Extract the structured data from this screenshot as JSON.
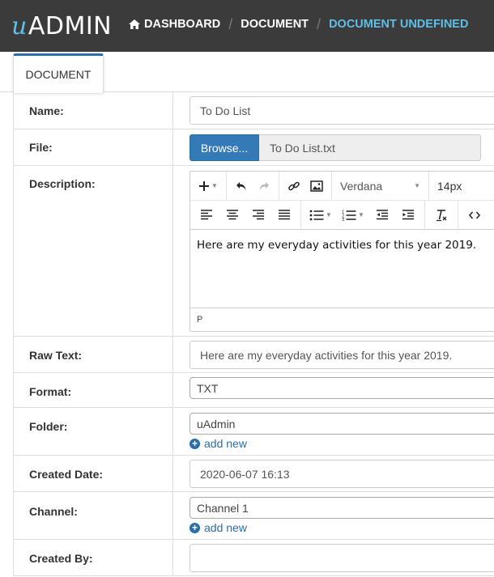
{
  "app": {
    "logo_prefix": "u",
    "logo_text": "ADMIN"
  },
  "breadcrumb": {
    "home_icon": "home-icon",
    "items": [
      "DASHBOARD",
      "DOCUMENT",
      "DOCUMENT UNDEFINED"
    ]
  },
  "tab": {
    "label": "DOCUMENT"
  },
  "form": {
    "name": {
      "label": "Name:",
      "value": "To Do List"
    },
    "file": {
      "label": "File:",
      "button": "Browse...",
      "filename": "To Do List.txt"
    },
    "description": {
      "label": "Description:",
      "font": "Verdana",
      "size": "14px",
      "content": "Here are my everyday activities for this year 2019.",
      "status_path": "P"
    },
    "raw_text": {
      "label": "Raw Text:",
      "value": "Here are my everyday activities for this year 2019."
    },
    "format": {
      "label": "Format:",
      "value": "TXT"
    },
    "folder": {
      "label": "Folder:",
      "value": "uAdmin",
      "add_new": "add new"
    },
    "created_date": {
      "label": "Created Date:",
      "value": "2020-06-07 16:13"
    },
    "channel": {
      "label": "Channel:",
      "value": "Channel 1",
      "add_new": "add new"
    },
    "created_by": {
      "label": "Created By:",
      "value": ""
    }
  },
  "colors": {
    "topbar": "#3b3b3b",
    "accent": "#5fbfe6",
    "primary": "#337ab7",
    "link": "#2a6ead"
  }
}
